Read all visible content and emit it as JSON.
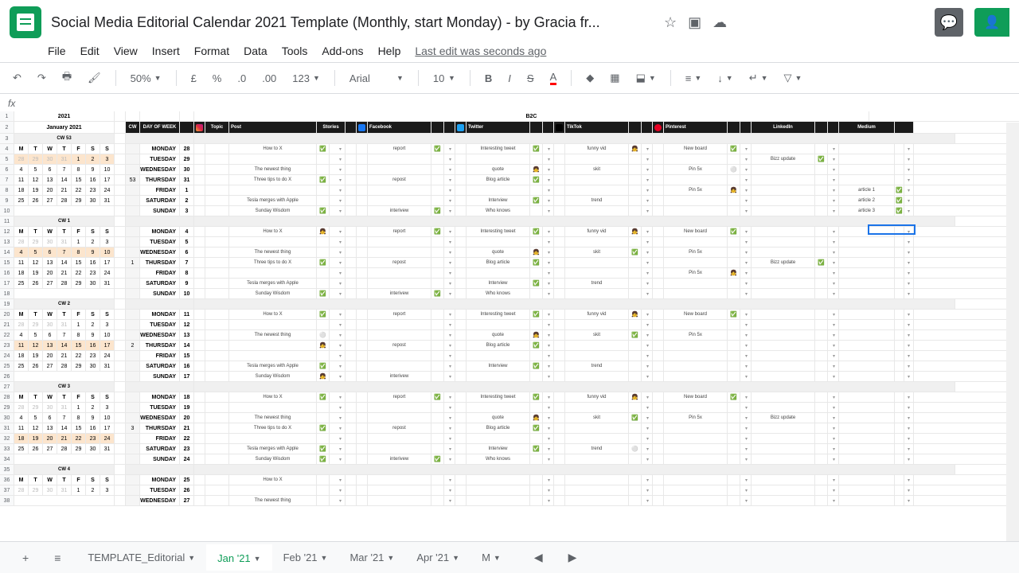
{
  "header": {
    "title": "Social Media Editorial Calendar 2021 Template (Monthly, start Monday) - by Gracia fr...",
    "last_edit": "Last edit was seconds ago"
  },
  "menus": [
    "File",
    "Edit",
    "View",
    "Insert",
    "Format",
    "Data",
    "Tools",
    "Add-ons",
    "Help"
  ],
  "toolbar": {
    "zoom": "50%",
    "font": "Arial",
    "size": "10"
  },
  "fx": "fx",
  "sheet": {
    "year_title": "2021",
    "month_title": "January 2021",
    "segment": "B2C",
    "col_labels": {
      "cw": "CW",
      "dow": "DAY OF WEEK",
      "topic": "Topic",
      "post": "Post",
      "stories": "Stories",
      "fb": "Facebook",
      "tw": "Twitter",
      "tt": "TikTok",
      "pin": "Pinterest",
      "li": "LinkedIn",
      "med": "Medium"
    },
    "cw_headers": [
      "CW 53",
      "CW 1",
      "CW 2",
      "CW 3",
      "CW 4"
    ],
    "mini_cal_days": [
      "M",
      "T",
      "W",
      "T",
      "F",
      "S",
      "S"
    ],
    "weeks": [
      {
        "cw": "53",
        "days": [
          {
            "day": "MONDAY",
            "date": "28",
            "post": "How to X",
            "stories": "✅",
            "fb": "report",
            "fb_s": "✅",
            "tw": "Interesting tweet",
            "tw_s": "✅",
            "tt": "funny vid",
            "tt_s": "👧",
            "pin": "New board",
            "pin_s": "✅",
            "li": "",
            "li_s": "",
            "med": ""
          },
          {
            "day": "TUESDAY",
            "date": "29",
            "post": "",
            "stories": "",
            "fb": "",
            "fb_s": "",
            "tw": "",
            "tw_s": "",
            "tt": "",
            "tt_s": "",
            "pin": "",
            "pin_s": "",
            "li": "Bizz update",
            "li_s": "✅",
            "med": ""
          },
          {
            "day": "WEDNESDAY",
            "date": "30",
            "post": "The newest thing",
            "stories": "",
            "fb": "",
            "fb_s": "",
            "tw": "quote",
            "tw_s": "👧",
            "tt": "skit",
            "tt_s": "",
            "pin": "Pin 5x",
            "pin_s": "⚪",
            "li": "",
            "li_s": "",
            "med": ""
          },
          {
            "day": "THURSDAY",
            "date": "31",
            "post": "Three tips to do X",
            "stories": "✅",
            "fb": "repost",
            "fb_s": "",
            "tw": "Blog article",
            "tw_s": "✅",
            "tt": "",
            "tt_s": "",
            "pin": "",
            "pin_s": "",
            "li": "",
            "li_s": "",
            "med": ""
          },
          {
            "day": "FRIDAY",
            "date": "1",
            "post": "",
            "stories": "",
            "fb": "",
            "fb_s": "",
            "tw": "",
            "tw_s": "",
            "tt": "",
            "tt_s": "",
            "pin": "Pin 5x",
            "pin_s": "👧",
            "li": "",
            "li_s": "",
            "med": "article 1"
          },
          {
            "day": "SATURDAY",
            "date": "2",
            "post": "Tesla merges with Apple",
            "stories": "",
            "fb": "",
            "fb_s": "",
            "tw": "Interview",
            "tw_s": "✅",
            "tt": "trend",
            "tt_s": "",
            "pin": "",
            "pin_s": "",
            "li": "",
            "li_s": "",
            "med": "article 2"
          },
          {
            "day": "SUNDAY",
            "date": "3",
            "post": "Sunday Wisdom",
            "stories": "✅",
            "fb": "interivew",
            "fb_s": "✅",
            "tw": "Who knows",
            "tw_s": "",
            "tt": "",
            "tt_s": "",
            "pin": "",
            "pin_s": "",
            "li": "",
            "li_s": "",
            "med": "article 3"
          }
        ]
      },
      {
        "cw": "1",
        "days": [
          {
            "day": "MONDAY",
            "date": "4",
            "post": "How to X",
            "stories": "👧",
            "fb": "report",
            "fb_s": "✅",
            "tw": "Interesting tweet",
            "tw_s": "✅",
            "tt": "funny vid",
            "tt_s": "👧",
            "pin": "New board",
            "pin_s": "✅",
            "li": "",
            "li_s": "",
            "med": ""
          },
          {
            "day": "TUESDAY",
            "date": "5",
            "post": "",
            "stories": "",
            "fb": "",
            "fb_s": "",
            "tw": "",
            "tw_s": "",
            "tt": "",
            "tt_s": "",
            "pin": "",
            "pin_s": "",
            "li": "",
            "li_s": "",
            "med": ""
          },
          {
            "day": "WEDNESDAY",
            "date": "6",
            "post": "The newest thing",
            "stories": "",
            "fb": "",
            "fb_s": "",
            "tw": "quote",
            "tw_s": "👧",
            "tt": "skit",
            "tt_s": "✅",
            "pin": "Pin 5x",
            "pin_s": "",
            "li": "",
            "li_s": "",
            "med": ""
          },
          {
            "day": "THURSDAY",
            "date": "7",
            "post": "Three tips to do X",
            "stories": "✅",
            "fb": "repost",
            "fb_s": "",
            "tw": "Blog article",
            "tw_s": "✅",
            "tt": "",
            "tt_s": "",
            "pin": "",
            "pin_s": "",
            "li": "Bizz update",
            "li_s": "✅",
            "med": ""
          },
          {
            "day": "FRIDAY",
            "date": "8",
            "post": "",
            "stories": "",
            "fb": "",
            "fb_s": "",
            "tw": "",
            "tw_s": "",
            "tt": "",
            "tt_s": "",
            "pin": "Pin 5x",
            "pin_s": "👧",
            "li": "",
            "li_s": "",
            "med": ""
          },
          {
            "day": "SATURDAY",
            "date": "9",
            "post": "Tesla merges with Apple",
            "stories": "",
            "fb": "",
            "fb_s": "",
            "tw": "Interview",
            "tw_s": "✅",
            "tt": "trend",
            "tt_s": "",
            "pin": "",
            "pin_s": "",
            "li": "",
            "li_s": "",
            "med": ""
          },
          {
            "day": "SUNDAY",
            "date": "10",
            "post": "Sunday Wisdom",
            "stories": "✅",
            "fb": "interivew",
            "fb_s": "✅",
            "tw": "Who knows",
            "tw_s": "",
            "tt": "",
            "tt_s": "",
            "pin": "",
            "pin_s": "",
            "li": "",
            "li_s": "",
            "med": ""
          }
        ]
      },
      {
        "cw": "2",
        "days": [
          {
            "day": "MONDAY",
            "date": "11",
            "post": "How to X",
            "stories": "✅",
            "fb": "report",
            "fb_s": "",
            "tw": "Interesting tweet",
            "tw_s": "✅",
            "tt": "funny vid",
            "tt_s": "👧",
            "pin": "New board",
            "pin_s": "✅",
            "li": "",
            "li_s": "",
            "med": ""
          },
          {
            "day": "TUESDAY",
            "date": "12",
            "post": "",
            "stories": "",
            "fb": "",
            "fb_s": "",
            "tw": "",
            "tw_s": "",
            "tt": "",
            "tt_s": "",
            "pin": "",
            "pin_s": "",
            "li": "",
            "li_s": "",
            "med": ""
          },
          {
            "day": "WEDNESDAY",
            "date": "13",
            "post": "The newest thing",
            "stories": "⚪",
            "fb": "",
            "fb_s": "",
            "tw": "quote",
            "tw_s": "👧",
            "tt": "skit",
            "tt_s": "✅",
            "pin": "Pin 5x",
            "pin_s": "",
            "li": "",
            "li_s": "",
            "med": ""
          },
          {
            "day": "THURSDAY",
            "date": "14",
            "post": "",
            "stories": "👧",
            "fb": "repost",
            "fb_s": "",
            "tw": "Blog article",
            "tw_s": "✅",
            "tt": "",
            "tt_s": "",
            "pin": "",
            "pin_s": "",
            "li": "",
            "li_s": "",
            "med": ""
          },
          {
            "day": "FRIDAY",
            "date": "15",
            "post": "",
            "stories": "",
            "fb": "",
            "fb_s": "",
            "tw": "",
            "tw_s": "",
            "tt": "",
            "tt_s": "",
            "pin": "",
            "pin_s": "",
            "li": "",
            "li_s": "",
            "med": ""
          },
          {
            "day": "SATURDAY",
            "date": "16",
            "post": "Tesla merges with Apple",
            "stories": "✅",
            "fb": "",
            "fb_s": "",
            "tw": "Interview",
            "tw_s": "✅",
            "tt": "trend",
            "tt_s": "",
            "pin": "",
            "pin_s": "",
            "li": "",
            "li_s": "",
            "med": ""
          },
          {
            "day": "SUNDAY",
            "date": "17",
            "post": "Sunday Wisdom",
            "stories": "👧",
            "fb": "interivew",
            "fb_s": "",
            "tw": "",
            "tw_s": "",
            "tt": "",
            "tt_s": "",
            "pin": "",
            "pin_s": "",
            "li": "",
            "li_s": "",
            "med": ""
          }
        ]
      },
      {
        "cw": "3",
        "days": [
          {
            "day": "MONDAY",
            "date": "18",
            "post": "How to X",
            "stories": "✅",
            "fb": "report",
            "fb_s": "✅",
            "tw": "Interesting tweet",
            "tw_s": "✅",
            "tt": "funny vid",
            "tt_s": "👧",
            "pin": "New board",
            "pin_s": "✅",
            "li": "",
            "li_s": "",
            "med": ""
          },
          {
            "day": "TUESDAY",
            "date": "19",
            "post": "",
            "stories": "",
            "fb": "",
            "fb_s": "",
            "tw": "",
            "tw_s": "",
            "tt": "",
            "tt_s": "",
            "pin": "",
            "pin_s": "",
            "li": "",
            "li_s": "",
            "med": ""
          },
          {
            "day": "WEDNESDAY",
            "date": "20",
            "post": "The newest thing",
            "stories": "",
            "fb": "",
            "fb_s": "",
            "tw": "quote",
            "tw_s": "👧",
            "tt": "skit",
            "tt_s": "✅",
            "pin": "Pin 5x",
            "pin_s": "",
            "li": "Bizz update",
            "li_s": "",
            "med": ""
          },
          {
            "day": "THURSDAY",
            "date": "21",
            "post": "Three tips to do X",
            "stories": "✅",
            "fb": "repost",
            "fb_s": "",
            "tw": "Blog article",
            "tw_s": "✅",
            "tt": "",
            "tt_s": "",
            "pin": "",
            "pin_s": "",
            "li": "",
            "li_s": "",
            "med": ""
          },
          {
            "day": "FRIDAY",
            "date": "22",
            "post": "",
            "stories": "",
            "fb": "",
            "fb_s": "",
            "tw": "",
            "tw_s": "",
            "tt": "",
            "tt_s": "",
            "pin": "",
            "pin_s": "",
            "li": "",
            "li_s": "",
            "med": ""
          },
          {
            "day": "SATURDAY",
            "date": "23",
            "post": "Tesla merges with Apple",
            "stories": "✅",
            "fb": "",
            "fb_s": "",
            "tw": "Interview",
            "tw_s": "✅",
            "tt": "trend",
            "tt_s": "⚪",
            "pin": "",
            "pin_s": "",
            "li": "",
            "li_s": "",
            "med": ""
          },
          {
            "day": "SUNDAY",
            "date": "24",
            "post": "Sunday Wisdom",
            "stories": "✅",
            "fb": "interivew",
            "fb_s": "✅",
            "tw": "Who knows",
            "tw_s": "",
            "tt": "",
            "tt_s": "",
            "pin": "",
            "pin_s": "",
            "li": "",
            "li_s": "",
            "med": ""
          }
        ]
      },
      {
        "cw": "4",
        "days": [
          {
            "day": "MONDAY",
            "date": "25",
            "post": "How to X",
            "stories": "",
            "fb": "",
            "fb_s": "",
            "tw": "",
            "tw_s": "",
            "tt": "",
            "tt_s": "",
            "pin": "",
            "pin_s": "",
            "li": "",
            "li_s": "",
            "med": ""
          },
          {
            "day": "TUESDAY",
            "date": "26",
            "post": "",
            "stories": "",
            "fb": "",
            "fb_s": "",
            "tw": "",
            "tw_s": "",
            "tt": "",
            "tt_s": "",
            "pin": "",
            "pin_s": "",
            "li": "",
            "li_s": "",
            "med": ""
          },
          {
            "day": "WEDNESDAY",
            "date": "27",
            "post": "The newest thing",
            "stories": "",
            "fb": "",
            "fb_s": "",
            "tw": "",
            "tw_s": "",
            "tt": "",
            "tt_s": "",
            "pin": "",
            "pin_s": "",
            "li": "",
            "li_s": "",
            "med": ""
          }
        ]
      }
    ],
    "mini_cals": [
      {
        "rows": [
          [
            "28",
            "29",
            "30",
            "31",
            "1",
            "2",
            "3"
          ],
          [
            "4",
            "5",
            "6",
            "7",
            "8",
            "9",
            "10"
          ],
          [
            "11",
            "12",
            "13",
            "14",
            "15",
            "16",
            "17"
          ],
          [
            "18",
            "19",
            "20",
            "21",
            "22",
            "23",
            "24"
          ],
          [
            "25",
            "26",
            "27",
            "28",
            "29",
            "30",
            "31"
          ]
        ],
        "hl_row": 0,
        "grey": [
          0,
          1,
          2,
          3
        ]
      },
      {
        "rows": [
          [
            "28",
            "29",
            "30",
            "31",
            "1",
            "2",
            "3"
          ],
          [
            "4",
            "5",
            "6",
            "7",
            "8",
            "9",
            "10"
          ],
          [
            "11",
            "12",
            "13",
            "14",
            "15",
            "16",
            "17"
          ],
          [
            "18",
            "19",
            "20",
            "21",
            "22",
            "23",
            "24"
          ],
          [
            "25",
            "26",
            "27",
            "28",
            "29",
            "30",
            "31"
          ]
        ],
        "hl_row": 1,
        "grey": [
          0,
          1,
          2,
          3
        ]
      },
      {
        "rows": [
          [
            "28",
            "29",
            "30",
            "31",
            "1",
            "2",
            "3"
          ],
          [
            "4",
            "5",
            "6",
            "7",
            "8",
            "9",
            "10"
          ],
          [
            "11",
            "12",
            "13",
            "14",
            "15",
            "16",
            "17"
          ],
          [
            "18",
            "19",
            "20",
            "21",
            "22",
            "23",
            "24"
          ],
          [
            "25",
            "26",
            "27",
            "28",
            "29",
            "30",
            "31"
          ]
        ],
        "hl_row": 2,
        "grey": [
          0,
          1,
          2,
          3
        ]
      },
      {
        "rows": [
          [
            "28",
            "29",
            "30",
            "31",
            "1",
            "2",
            "3"
          ],
          [
            "4",
            "5",
            "6",
            "7",
            "8",
            "9",
            "10"
          ],
          [
            "11",
            "12",
            "13",
            "14",
            "15",
            "16",
            "17"
          ],
          [
            "18",
            "19",
            "20",
            "21",
            "22",
            "23",
            "24"
          ],
          [
            "25",
            "26",
            "27",
            "28",
            "29",
            "30",
            "31"
          ]
        ],
        "hl_row": 3,
        "grey": [
          0,
          1,
          2,
          3
        ]
      },
      {
        "rows": [
          [
            "28",
            "29",
            "30",
            "31",
            "1",
            "2",
            "3"
          ]
        ],
        "hl_row": -1,
        "grey": [
          0,
          1,
          2,
          3
        ]
      }
    ]
  },
  "tabs": [
    "TEMPLATE_Editorial",
    "Jan '21",
    "Feb '21",
    "Mar '21",
    "Apr '21",
    "M"
  ],
  "active_tab": 1
}
